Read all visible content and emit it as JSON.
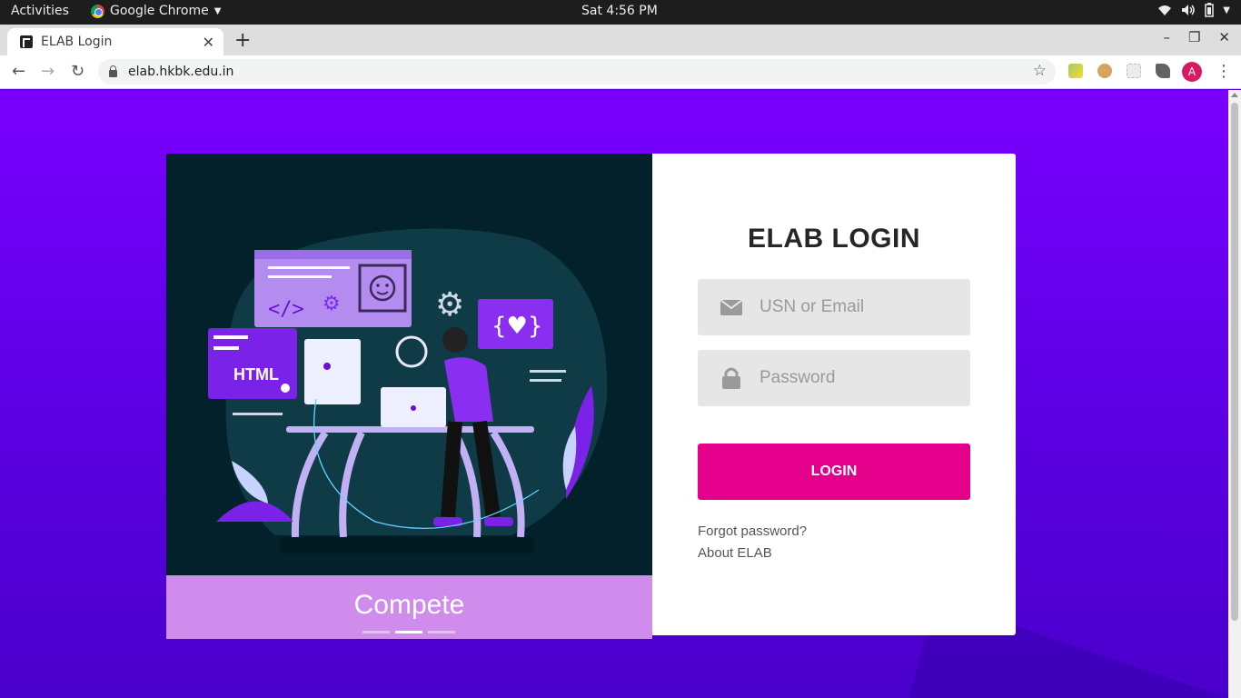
{
  "system_bar": {
    "activities": "Activities",
    "app_name": "Google Chrome",
    "clock": "Sat  4:56 PM"
  },
  "browser": {
    "tab_title": "ELAB Login",
    "url": "elab.hkbk.edu.in",
    "profile_initial": "A"
  },
  "carousel": {
    "caption": "Compete",
    "illustration_labels": {
      "html": "HTML",
      "braces": "{♥}"
    },
    "slides": 3,
    "active_slide": 2
  },
  "login": {
    "title": "ELAB LOGIN",
    "username_placeholder": "USN or Email",
    "password_placeholder": "Password",
    "submit_label": "LOGIN",
    "forgot_label": "Forgot password?",
    "about_label": "About ELAB"
  },
  "colors": {
    "page_gradient_top": "#7a00ff",
    "page_gradient_bottom": "#4a00cc",
    "login_button": "#e4008a",
    "caption_band": "#d08cec",
    "illustration_bg": "#03212a"
  }
}
